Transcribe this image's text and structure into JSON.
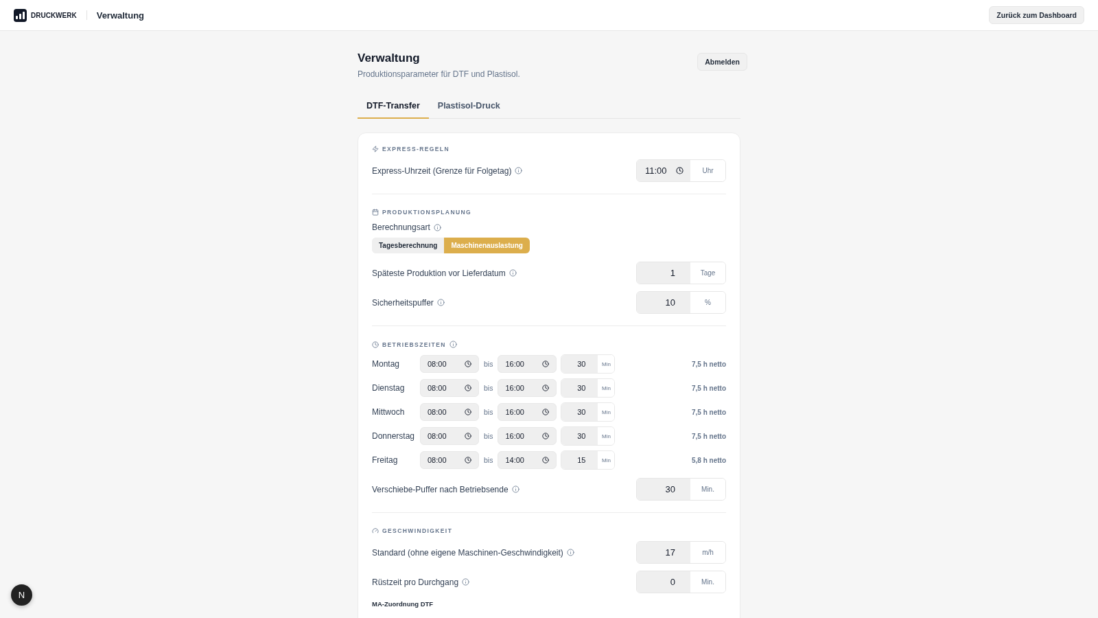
{
  "header": {
    "brand": "DRUCKWERK",
    "section": "Verwaltung",
    "back_button": "Zurück zum Dashboard"
  },
  "page": {
    "title": "Verwaltung",
    "subtitle": "Produktionsparameter für DTF und Plastisol.",
    "logout_button": "Abmelden"
  },
  "tabs": [
    {
      "label": "DTF-Transfer",
      "selected": true
    },
    {
      "label": "Plastisol-Druck",
      "selected": false
    }
  ],
  "express": {
    "title": "EXPRESS-REGELN",
    "fields": [
      {
        "kind": "time",
        "label": "Express-Uhrzeit (Grenze für Folgetag)",
        "info": true,
        "value": "11:00",
        "unit": "Uhr"
      }
    ]
  },
  "planning": {
    "title": "PRODUKTIONSPLANUNG",
    "mode_label": "Berechnungsart",
    "mode_info": true,
    "modes": [
      {
        "label": "Tagesberechnung",
        "selected": false
      },
      {
        "label": "Maschinenauslastung",
        "selected": true
      }
    ],
    "fields": [
      {
        "kind": "number",
        "label": "Späteste Produktion vor Lieferdatum",
        "info": true,
        "value": "1",
        "unit": "Tage"
      },
      {
        "kind": "number",
        "label": "Sicherheitspuffer",
        "info": true,
        "value": "10",
        "unit": "%"
      }
    ]
  },
  "operating_hours": {
    "title": "BETRIEBSZEITEN",
    "info": true,
    "days": [
      {
        "day": "Montag",
        "from": "08:00",
        "separator": "bis",
        "to": "16:00",
        "break": "30",
        "break_unit": "Min",
        "net": "7,5 h netto"
      },
      {
        "day": "Dienstag",
        "from": "08:00",
        "separator": "bis",
        "to": "16:00",
        "break": "30",
        "break_unit": "Min",
        "net": "7,5 h netto"
      },
      {
        "day": "Mittwoch",
        "from": "08:00",
        "separator": "bis",
        "to": "16:00",
        "break": "30",
        "break_unit": "Min",
        "net": "7,5 h netto"
      },
      {
        "day": "Donnerstag",
        "from": "08:00",
        "separator": "bis",
        "to": "16:00",
        "break": "30",
        "break_unit": "Min",
        "net": "7,5 h netto"
      },
      {
        "day": "Freitag",
        "from": "08:00",
        "separator": "bis",
        "to": "14:00",
        "break": "15",
        "break_unit": "Min",
        "net": "5,8 h netto"
      }
    ],
    "fields": [
      {
        "kind": "number",
        "label": "Verschiebe-Puffer nach Betriebsende",
        "info": true,
        "value": "30",
        "unit": "Min."
      }
    ]
  },
  "speed": {
    "title": "GESCHWINDIGKEIT",
    "fields": [
      {
        "kind": "number",
        "label": "Standard (ohne eigene Maschinen-Geschwindigkeit)",
        "info": true,
        "value": "17",
        "unit": "m/h"
      },
      {
        "kind": "number",
        "label": "Rüstzeit pro Durchgang",
        "info": true,
        "value": "0",
        "unit": "Min."
      }
    ],
    "subheading": "MA-Zuordnung DTF"
  },
  "dev_badge": "N"
}
